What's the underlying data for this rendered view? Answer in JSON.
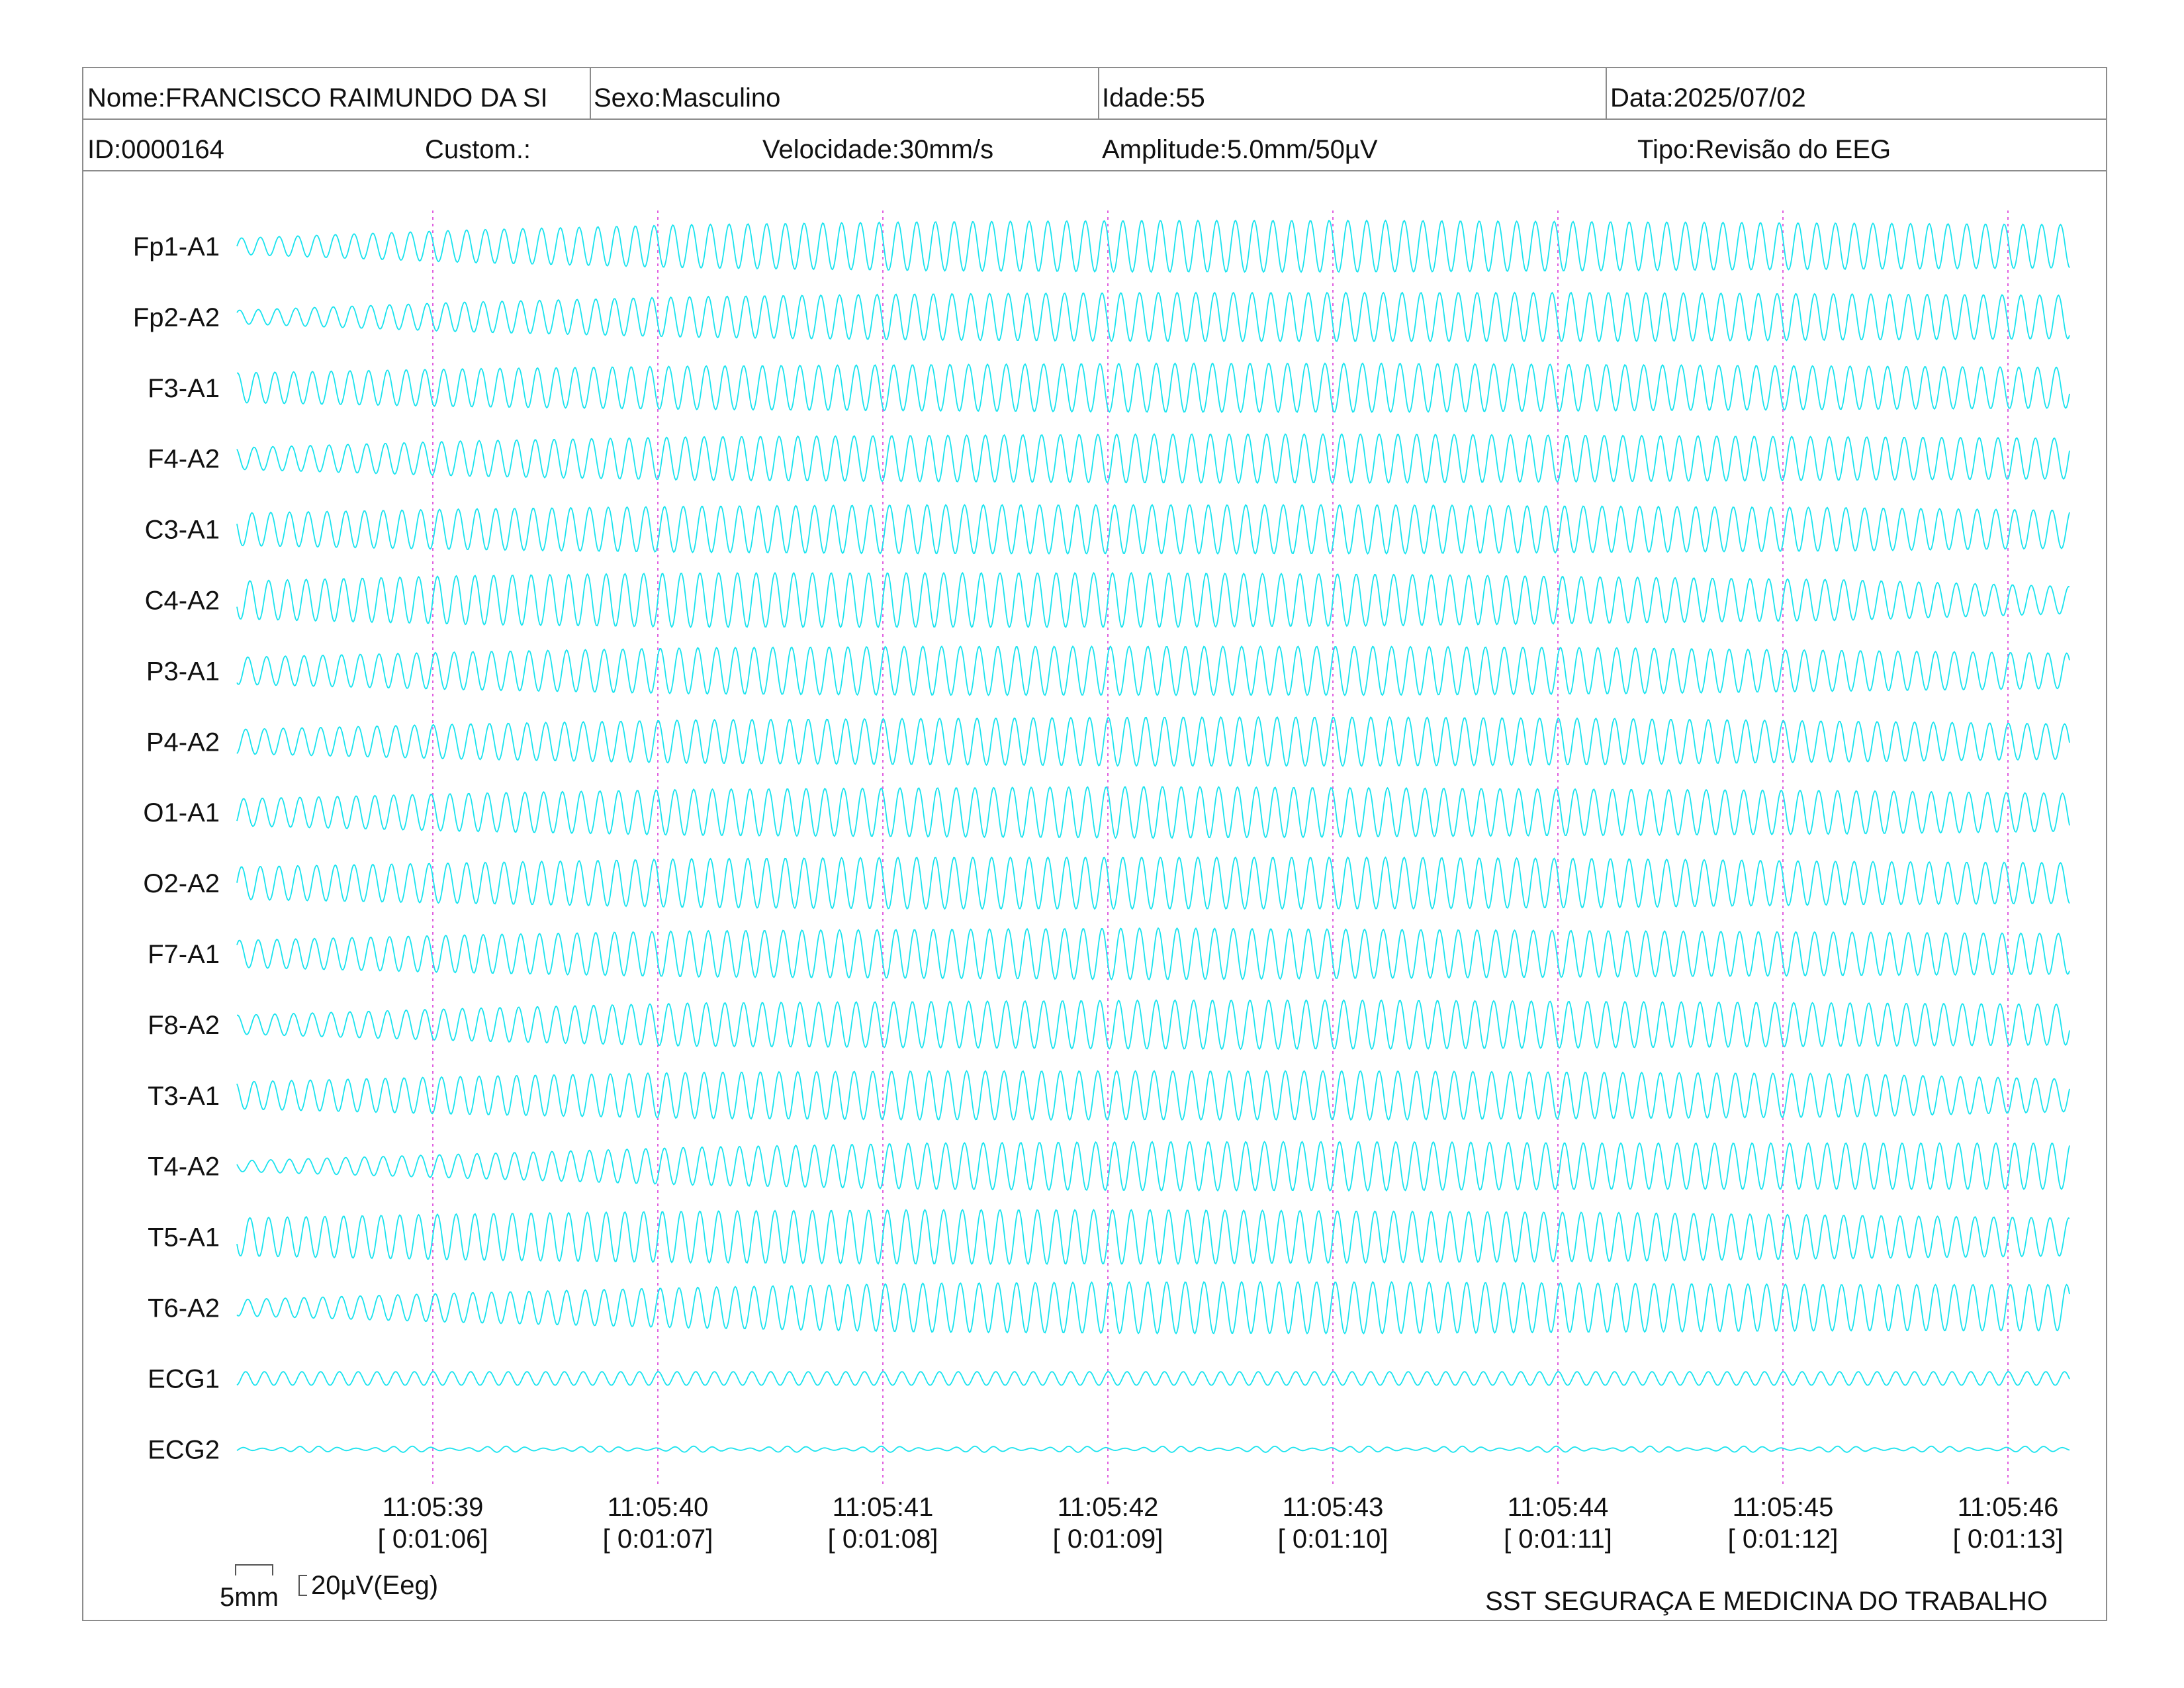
{
  "header": {
    "nome": "Nome:FRANCISCO RAIMUNDO DA SI",
    "sexo": "Sexo:Masculino",
    "idade": "Idade:55",
    "data": "Data:2025/07/02",
    "id": "ID:0000164",
    "custom": "Custom.:",
    "velocidade": "Velocidade:30mm/s",
    "amplitude": "Amplitude:5.0mm/50µV",
    "tipo": "Tipo:Revisão do EEG"
  },
  "scale": {
    "time_label": "5mm",
    "amp_label": "20µV(Eeg)"
  },
  "footer": {
    "organization": "SST SEGURAÇA E MEDICINA DO TRABALHO"
  },
  "colors": {
    "trace": "#19e3ee",
    "marker": "#e060e0",
    "border": "#8c8c8c"
  },
  "chart_data": {
    "type": "line",
    "title": "",
    "xlabel": "",
    "ylabel": "",
    "grid": false,
    "x_unit": "seconds",
    "time_range": [
      "11:05:38.15",
      "11:05:46.25"
    ],
    "markers": [
      {
        "time": "11:05:39",
        "elapsed": "[ 0:01:06]"
      },
      {
        "time": "11:05:40",
        "elapsed": "[ 0:01:07]"
      },
      {
        "time": "11:05:41",
        "elapsed": "[ 0:01:08]"
      },
      {
        "time": "11:05:42",
        "elapsed": "[ 0:01:09]"
      },
      {
        "time": "11:05:43",
        "elapsed": "[ 0:01:10]"
      },
      {
        "time": "11:05:44",
        "elapsed": "[ 0:01:11]"
      },
      {
        "time": "11:05:45",
        "elapsed": "[ 0:01:12]"
      },
      {
        "time": "11:05:46",
        "elapsed": "[ 0:01:13]"
      }
    ],
    "series": [
      {
        "name": "Fp1-A1",
        "frequency_hz": 12,
        "amplitude_uV": [
          6,
          12,
          16,
          18,
          19,
          19,
          18,
          17,
          16
        ]
      },
      {
        "name": "Fp2-A2",
        "frequency_hz": 12,
        "amplitude_uV": [
          5,
          11,
          15,
          17,
          18,
          18,
          18,
          17,
          16
        ]
      },
      {
        "name": "F3-A1",
        "frequency_hz": 12,
        "amplitude_uV": [
          11,
          14,
          16,
          17,
          18,
          18,
          17,
          16,
          15
        ]
      },
      {
        "name": "F4-A2",
        "frequency_hz": 12,
        "amplitude_uV": [
          8,
          13,
          16,
          17,
          18,
          18,
          17,
          16,
          15
        ]
      },
      {
        "name": "C3-A1",
        "frequency_hz": 12,
        "amplitude_uV": [
          12,
          15,
          17,
          18,
          18,
          18,
          17,
          16,
          14
        ]
      },
      {
        "name": "C4-A2",
        "frequency_hz": 12,
        "amplitude_uV": [
          14,
          18,
          20,
          20,
          20,
          19,
          17,
          15,
          10
        ]
      },
      {
        "name": "P3-A1",
        "frequency_hz": 12,
        "amplitude_uV": [
          10,
          14,
          17,
          18,
          18,
          18,
          17,
          15,
          13
        ]
      },
      {
        "name": "P4-A2",
        "frequency_hz": 12,
        "amplitude_uV": [
          9,
          13,
          16,
          17,
          18,
          18,
          17,
          15,
          13
        ]
      },
      {
        "name": "O1-A1",
        "frequency_hz": 12,
        "amplitude_uV": [
          10,
          14,
          17,
          18,
          19,
          18,
          17,
          16,
          14
        ]
      },
      {
        "name": "O2-A2",
        "frequency_hz": 12,
        "amplitude_uV": [
          12,
          15,
          18,
          19,
          19,
          19,
          18,
          16,
          15
        ]
      },
      {
        "name": "F7-A1",
        "frequency_hz": 12,
        "amplitude_uV": [
          10,
          14,
          17,
          18,
          19,
          18,
          17,
          16,
          15
        ]
      },
      {
        "name": "F8-A2",
        "frequency_hz": 12,
        "amplitude_uV": [
          7,
          12,
          16,
          17,
          18,
          18,
          17,
          16,
          15
        ]
      },
      {
        "name": "T3-A1",
        "frequency_hz": 12,
        "amplitude_uV": [
          10,
          14,
          17,
          18,
          18,
          18,
          17,
          16,
          12
        ]
      },
      {
        "name": "T4-A2",
        "frequency_hz": 12,
        "amplitude_uV": [
          4,
          9,
          14,
          17,
          18,
          18,
          17,
          17,
          17
        ]
      },
      {
        "name": "T5-A1",
        "frequency_hz": 12,
        "amplitude_uV": [
          14,
          17,
          19,
          20,
          20,
          19,
          18,
          16,
          14
        ]
      },
      {
        "name": "T6-A2",
        "frequency_hz": 12,
        "amplitude_uV": [
          6,
          11,
          15,
          18,
          19,
          19,
          18,
          17,
          17
        ]
      },
      {
        "name": "ECG1",
        "frequency_hz": 12,
        "amplitude_uV": [
          5,
          5,
          5,
          5,
          5,
          5,
          5,
          5,
          5
        ]
      },
      {
        "name": "ECG2",
        "frequency_hz": 12,
        "amplitude_uV": [
          1.5,
          1.5,
          1.5,
          1.5,
          1.5,
          1.5,
          1.5,
          1.5,
          1.5
        ]
      }
    ]
  }
}
